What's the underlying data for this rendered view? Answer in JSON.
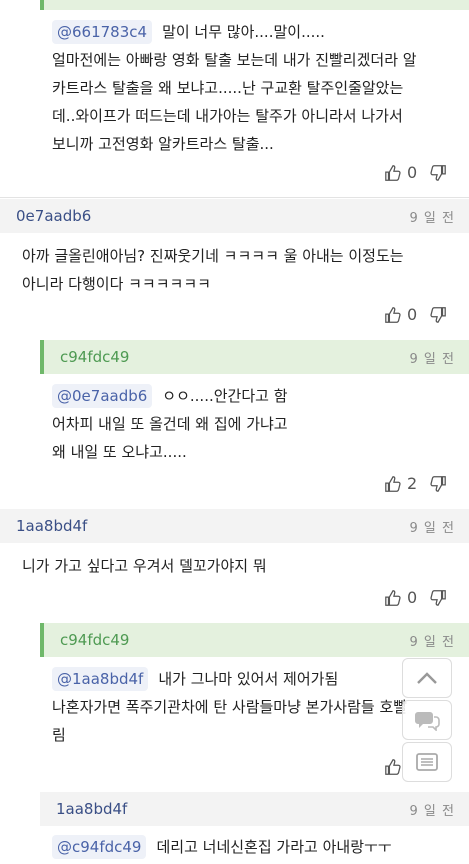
{
  "comments": [
    {
      "mention": "@661783c4",
      "text_first": "말이 너무 많아....말이.....",
      "text_rest": "얼마전에는 아빠랑 영화 탈출 보는데 내가 진빨리겠더라 알\n카트라스 탈출을 왜 보냐고.....난 구교환 탈주인줄알았는\n데..와이프가 떠드는데 내가아는 탈주가 아니라서 나가서\n보니까 고전영화 알카트라스 탈출...",
      "likes": "0"
    },
    {
      "author": "0e7aadb6",
      "date": "9 일 전",
      "text": "아까 글올린애아님? 진짜웃기네 ㅋㅋㅋㅋ 울 아내는 이정도는\n아니라 다행이다 ㅋㅋㅋㅋㅋㅋ",
      "likes": "0"
    },
    {
      "author": "c94fdc49",
      "date": "9 일 전",
      "mention": "@0e7aadb6",
      "text_first": "ㅇㅇ.....안간다고 함",
      "text_rest": "어차피 내일 또 올건데 왜 집에 가냐고\n왜 내일 또 오냐고.....",
      "likes": "2"
    },
    {
      "author": "1aa8bd4f",
      "date": "9 일 전",
      "text": "니가 가고 싶다고 우겨서 델꼬가야지 뭐",
      "likes": "0"
    },
    {
      "author": "c94fdc49",
      "date": "9 일 전",
      "mention": "@1aa8bd4f",
      "text_first": "내가 그나마 있어서 제어가됨",
      "text_rest": "나혼자가면 폭주기관차에 탄 사람들마냥 본가사람들 호빨\n림"
    },
    {
      "author": "1aa8bd4f",
      "date": "9 일 전",
      "mention": "@c94fdc49",
      "text_first": "데리고 너네신혼집 가라고 아내랑ㅜㅜ"
    }
  ],
  "icons": {
    "like": "thumbs-up-icon",
    "dislike": "thumbs-down-icon",
    "scroll_top": "chevron-up-icon",
    "chat": "chat-bubble-icon",
    "list": "list-icon"
  },
  "colors": {
    "reply_header_bg": "#e4f1de",
    "header_bg": "#f3f3f3",
    "reply_accent": "#6fb86a",
    "reply_author": "#4e9a52",
    "author": "#3a4f86",
    "mention_bg": "#eef1f8",
    "mention_text": "#4a63a8"
  }
}
